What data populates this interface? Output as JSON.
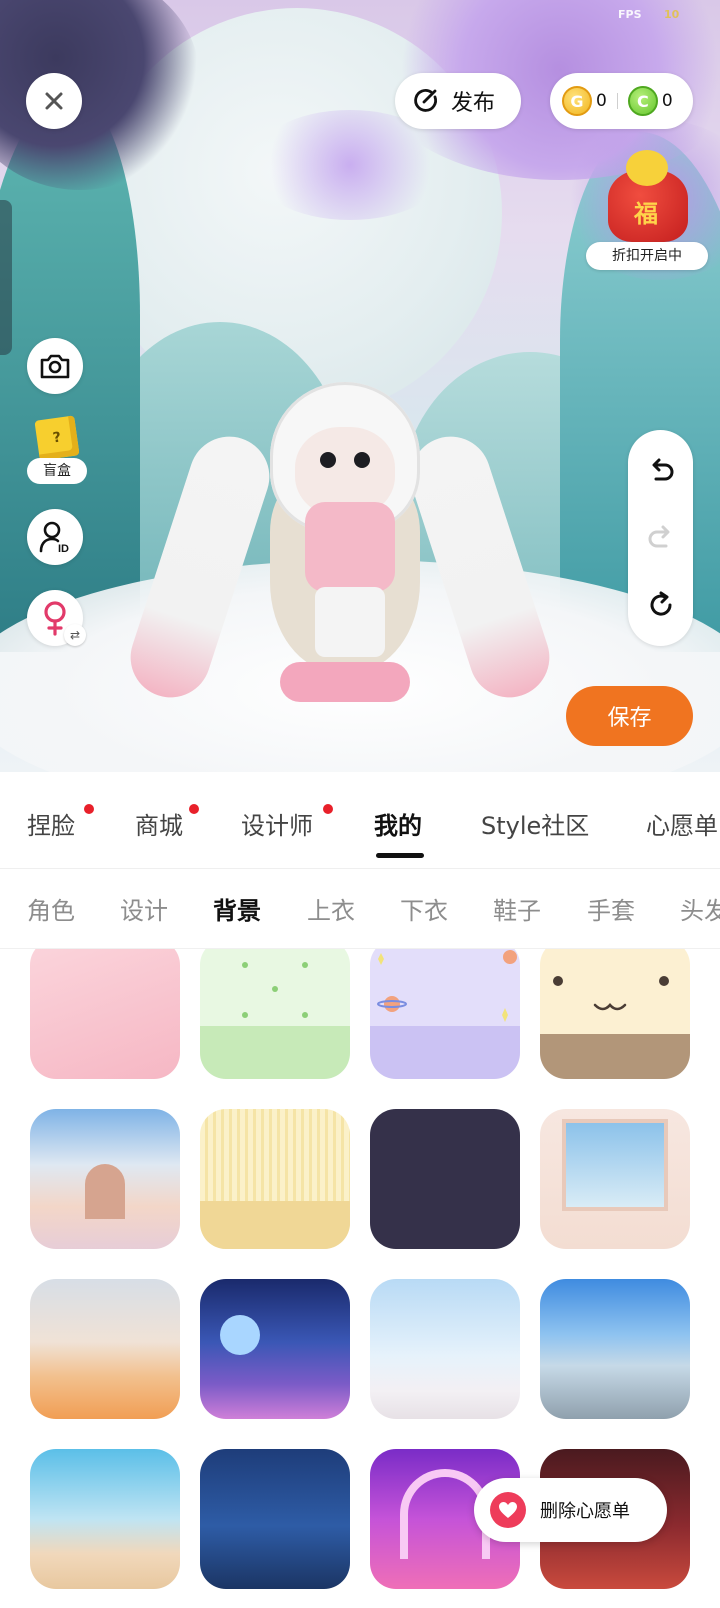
{
  "status": {
    "fps_label": "FPS",
    "fps_value": "10"
  },
  "toolbar": {
    "publish_label": "发布",
    "coins": [
      {
        "icon": "gold-g-coin-icon",
        "value": "0",
        "color": "#f1b51f"
      },
      {
        "icon": "green-c-coin-icon",
        "value": "0",
        "color": "#65c62d"
      }
    ]
  },
  "promo": {
    "icon": "fortune-bag-icon",
    "glyph": "福",
    "label": "折扣开启中"
  },
  "left_tools": {
    "camera_icon": "camera-icon",
    "blind_box": {
      "glyph": "?",
      "label": "盲盒"
    },
    "id_icon": "user-id-icon",
    "gender_icon": "female-gender-icon",
    "swap_glyph": "⇄"
  },
  "history": {
    "undo_icon": "undo-icon",
    "redo_icon": "redo-icon",
    "reset_icon": "reset-icon"
  },
  "save_label": "保存",
  "tabs": [
    {
      "label": "捏脸",
      "dot": true
    },
    {
      "label": "商城",
      "dot": true
    },
    {
      "label": "设计师",
      "dot": true
    },
    {
      "label": "我的",
      "dot": false,
      "active": true
    },
    {
      "label": "Style社区",
      "dot": false
    },
    {
      "label": "心愿单",
      "dot": false
    }
  ],
  "categories": [
    {
      "label": "角色"
    },
    {
      "label": "设计"
    },
    {
      "label": "背景",
      "active": true
    },
    {
      "label": "上衣"
    },
    {
      "label": "下衣"
    },
    {
      "label": "鞋子"
    },
    {
      "label": "手套"
    },
    {
      "label": "头发"
    }
  ],
  "backgrounds": [
    {
      "name": "pink-gradient"
    },
    {
      "name": "green-dots"
    },
    {
      "name": "lavender-planets"
    },
    {
      "name": "cream-face"
    },
    {
      "name": "palace-hall"
    },
    {
      "name": "yellow-stripes"
    },
    {
      "name": "dark-navy"
    },
    {
      "name": "window-room"
    },
    {
      "name": "desert-dunes"
    },
    {
      "name": "night-city-balcony"
    },
    {
      "name": "sky-window"
    },
    {
      "name": "rooftop-city"
    },
    {
      "name": "bridge-sky"
    },
    {
      "name": "blue-night-room"
    },
    {
      "name": "purple-stage"
    },
    {
      "name": "red-lantern-street"
    }
  ],
  "wishlist_action": {
    "icon": "heart-icon",
    "label": "删除心愿单"
  }
}
